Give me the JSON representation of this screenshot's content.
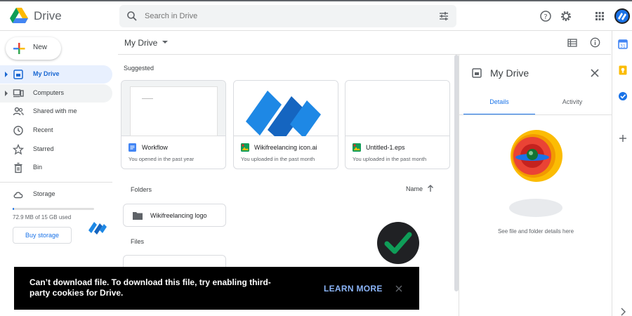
{
  "app": {
    "name": "Drive"
  },
  "search": {
    "placeholder": "Search in Drive"
  },
  "sidebar": {
    "new_label": "New",
    "items": [
      {
        "label": "My Drive",
        "icon": "my-drive-icon"
      },
      {
        "label": "Computers",
        "icon": "computers-icon"
      },
      {
        "label": "Shared with me",
        "icon": "shared-icon"
      },
      {
        "label": "Recent",
        "icon": "clock-icon"
      },
      {
        "label": "Starred",
        "icon": "star-icon"
      },
      {
        "label": "Bin",
        "icon": "trash-icon"
      },
      {
        "label": "Storage",
        "icon": "cloud-icon"
      }
    ],
    "storage": {
      "used_text": "72.9 MB of 15 GB used",
      "used_fraction": 0.005,
      "buy_label": "Buy storage"
    }
  },
  "main": {
    "location": "My Drive",
    "suggested_label": "Suggested",
    "suggested": [
      {
        "name": "Workflow",
        "sub": "You opened in the past year",
        "type": "doc"
      },
      {
        "name": "Wikifreelancing icon.ai",
        "sub": "You uploaded in the past month",
        "type": "image"
      },
      {
        "name": "Untitled-1.eps",
        "sub": "You uploaded in the past month",
        "type": "image"
      }
    ],
    "folders_label": "Folders",
    "sort_label": "Name",
    "folders": [
      {
        "name": "Wikifreelancing logo"
      }
    ],
    "files_label": "Files"
  },
  "panel": {
    "title": "My Drive",
    "tabs": [
      "Details",
      "Activity"
    ],
    "hint": "See file and folder details here"
  },
  "toast": {
    "message": "Can’t download file. To download this file, try enabling third-party cookies for Drive.",
    "action": "LEARN MORE",
    "close": "x"
  },
  "colors": {
    "accent": "#1a73e8",
    "active_bg": "#e8f0fe",
    "toast_bg": "#000000",
    "toast_action": "#8ab4f8",
    "check": "#0f9d58"
  }
}
